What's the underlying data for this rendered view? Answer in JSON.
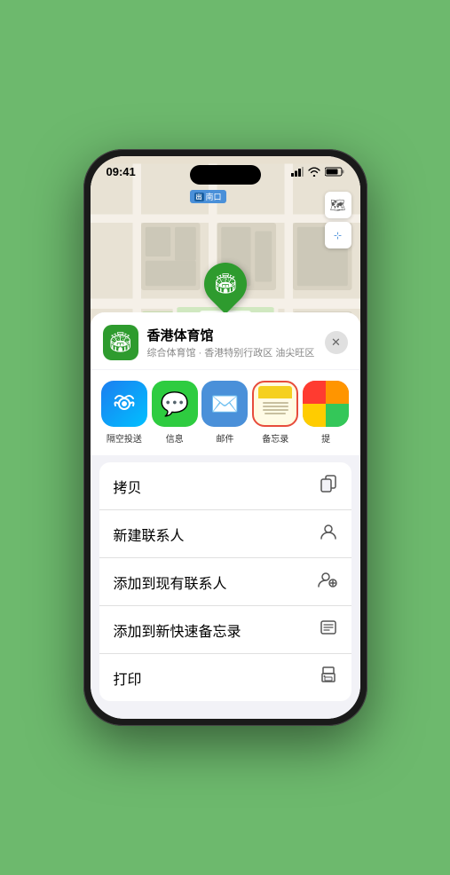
{
  "status": {
    "time": "09:41",
    "time_arrow": "▶"
  },
  "map": {
    "label": "南口",
    "map_icon": "🗺",
    "location_icon": "◎",
    "compass_icon": "⊹"
  },
  "venue": {
    "name": "香港体育馆",
    "description": "综合体育馆 · 香港特别行政区 油尖旺区",
    "icon": "🏟",
    "close": "✕"
  },
  "share_items": [
    {
      "label": "隔空投送",
      "type": "airdrop"
    },
    {
      "label": "信息",
      "type": "messages"
    },
    {
      "label": "邮件",
      "type": "mail"
    },
    {
      "label": "备忘录",
      "type": "notes"
    },
    {
      "label": "提",
      "type": "more"
    }
  ],
  "actions": [
    {
      "label": "拷贝",
      "icon": "📋"
    },
    {
      "label": "新建联系人",
      "icon": "👤"
    },
    {
      "label": "添加到现有联系人",
      "icon": "👤"
    },
    {
      "label": "添加到新快速备忘录",
      "icon": "🖼"
    },
    {
      "label": "打印",
      "icon": "🖨"
    }
  ]
}
